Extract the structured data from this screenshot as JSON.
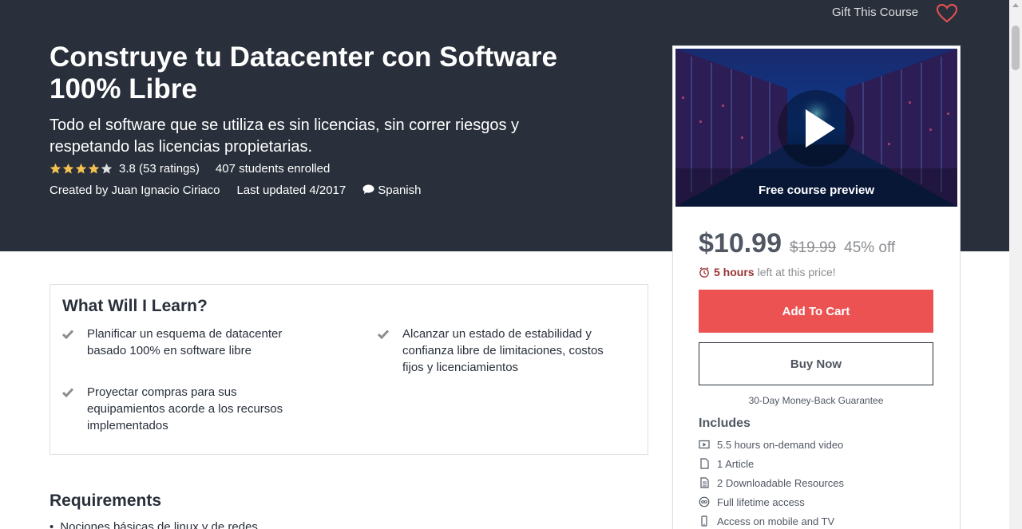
{
  "header": {
    "gift_label": "Gift This Course"
  },
  "course": {
    "title": "Construye tu Datacenter con Software 100% Libre",
    "subtitle": "Todo el software que se utiliza es sin licencias, sin correr riesgos y respetando las licencias propietarias.",
    "rating_value": 4,
    "rating_text": "3.8 (53 ratings)",
    "students": "407 students enrolled",
    "created_by": "Created by Juan Ignacio Ciriaco",
    "last_updated": "Last updated 4/2017",
    "language": "Spanish"
  },
  "sidebar": {
    "preview_label": "Free course preview",
    "price": "$10.99",
    "old_price": "$19.99",
    "discount": "45% off",
    "timer_hours": "5 hours",
    "timer_suffix": "left at this price!",
    "add_to_cart": "Add To Cart",
    "buy_now": "Buy Now",
    "guarantee": "30-Day Money-Back Guarantee",
    "includes_title": "Includes",
    "includes": [
      {
        "icon": "video-icon",
        "label": "5.5 hours on-demand video"
      },
      {
        "icon": "article-icon",
        "label": "1 Article"
      },
      {
        "icon": "resource-icon",
        "label": "2 Downloadable Resources"
      },
      {
        "icon": "infinity-icon",
        "label": "Full lifetime access"
      },
      {
        "icon": "mobile-icon",
        "label": "Access on mobile and TV"
      }
    ]
  },
  "learn": {
    "title": "What Will I Learn?",
    "items": [
      "Planificar un esquema de datacenter basado 100% en software libre",
      "Alcanzar un estado de estabilidad y confianza libre de limitaciones, costos fijos y licenciamientos",
      "Proyectar compras para sus equipamientos acorde a los recursos implementados"
    ]
  },
  "requirements": {
    "title": "Requirements",
    "items": [
      "Nociones básicas de linux y de redes"
    ]
  },
  "colors": {
    "hero_bg": "#29303b",
    "accent": "#ec5252",
    "star": "#f4c150",
    "timer": "#993333"
  }
}
